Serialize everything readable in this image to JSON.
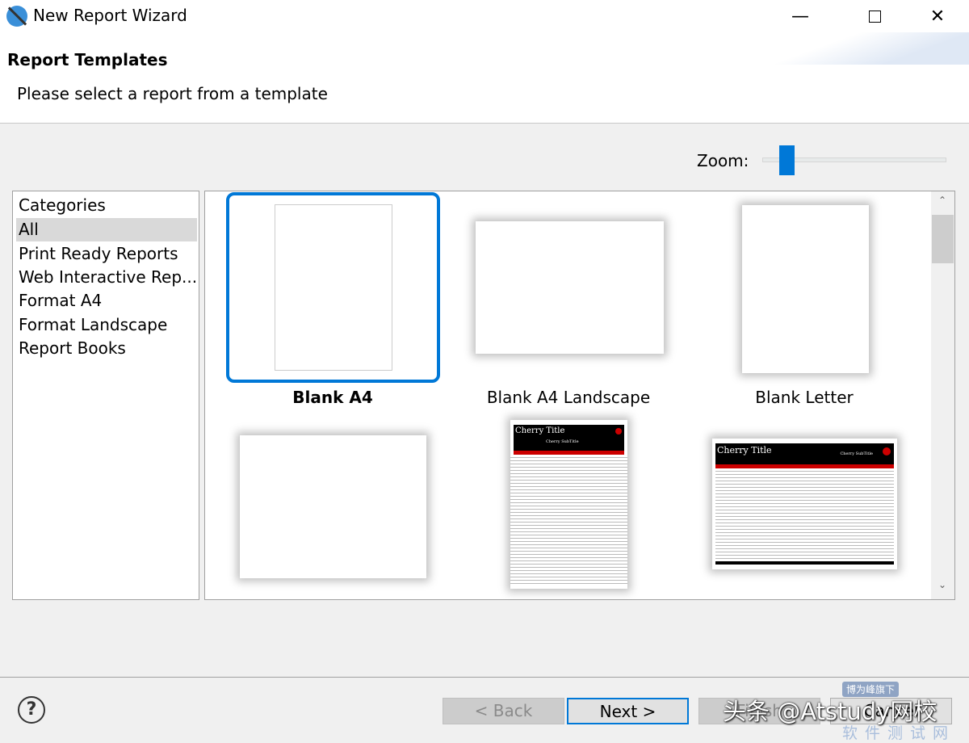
{
  "window": {
    "title": "New Report Wizard",
    "controls": [
      "minimize",
      "maximize",
      "close"
    ]
  },
  "header": {
    "title": "Report Templates",
    "description": "Please select a report from a template"
  },
  "zoom": {
    "label": "Zoom:",
    "value_fraction": 0.1
  },
  "categories": {
    "header": "Categories",
    "items": [
      {
        "label": "All",
        "selected": true
      },
      {
        "label": "Print Ready Reports"
      },
      {
        "label": "Web Interactive Rep..."
      },
      {
        "label": "Format A4"
      },
      {
        "label": "Format Landscape"
      },
      {
        "label": "Report Books"
      }
    ]
  },
  "templates": [
    {
      "label": "Blank A4",
      "selected": true
    },
    {
      "label": "Blank A4 Landscape"
    },
    {
      "label": "Blank Letter"
    },
    {
      "label": ""
    },
    {
      "label": "",
      "thumb_title": "Cherry Title",
      "thumb_subtitle": "Cherry SubTitle"
    },
    {
      "label": "",
      "thumb_title": "Cherry Title",
      "thumb_subtitle": "Cherry SubTitle"
    }
  ],
  "buttons": {
    "back": "< Back",
    "next": "Next >",
    "finish": "Finish",
    "cancel": "Cancel"
  },
  "watermark": {
    "main": "头条 @Atstudy网校",
    "badge": "博为峰旗下",
    "sub": "软件测试网"
  },
  "colors": {
    "selection": "#0078d7",
    "accent_red": "#cc0000"
  }
}
